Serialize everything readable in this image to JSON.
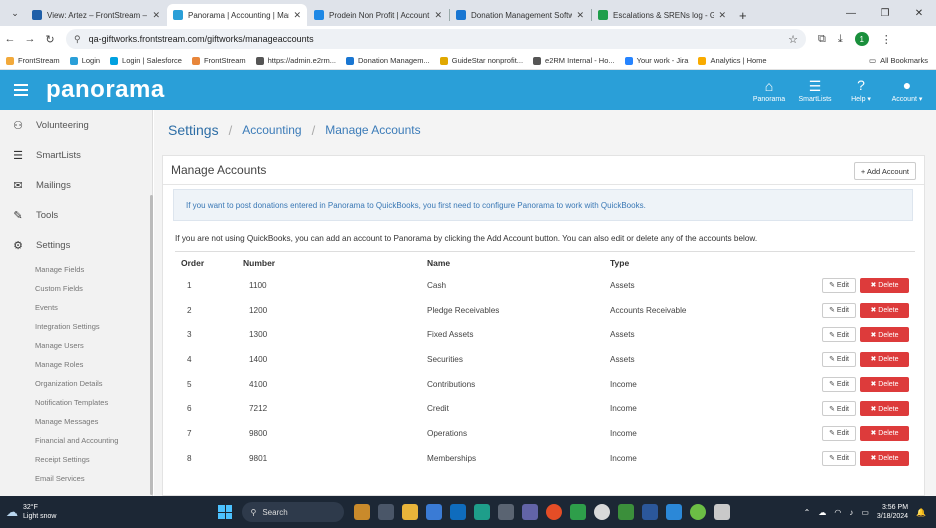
{
  "browser": {
    "tabs": [
      {
        "title": "View: Artez – FrontStream – Ze",
        "color": "#1f5fa8",
        "active": false
      },
      {
        "title": "Panorama | Accounting | Mana",
        "color": "#2a9fd8",
        "active": true
      },
      {
        "title": "Prodein Non Profit | Account | ",
        "color": "#1e88e5",
        "active": false
      },
      {
        "title": "Donation Management Softwa",
        "color": "#1976d2",
        "active": false
      },
      {
        "title": "Escalations & SRENs log - Goog",
        "color": "#1e9e4a",
        "active": false
      }
    ],
    "url": "qa-giftworks.frontstream.com/giftworks/manageaccounts",
    "bookmarks": [
      {
        "label": "FrontStream",
        "color": "#f2a93b"
      },
      {
        "label": "Login",
        "color": "#2a9fd8"
      },
      {
        "label": "Login | Salesforce",
        "color": "#00a1e0"
      },
      {
        "label": "FrontStream",
        "color": "#e8863a"
      },
      {
        "label": "https://admin.e2rm...",
        "color": "#555555"
      },
      {
        "label": "Donation Managem...",
        "color": "#1976d2"
      },
      {
        "label": "GuideStar nonprofit...",
        "color": "#e0a800"
      },
      {
        "label": "e2RM Internal - Ho...",
        "color": "#555555"
      },
      {
        "label": "Your work - Jira",
        "color": "#2684ff"
      },
      {
        "label": "Analytics | Home",
        "color": "#f9ab00"
      }
    ],
    "all_bookmarks": "All Bookmarks",
    "profile_initial": "1"
  },
  "app": {
    "logo": "panorama",
    "header_items": [
      {
        "label": "Panorama",
        "icon": "home-icon",
        "glyph": "⌂"
      },
      {
        "label": "SmartLists",
        "icon": "list-icon",
        "glyph": "☰"
      },
      {
        "label": "Help ▾",
        "icon": "question-icon",
        "glyph": "?"
      },
      {
        "label": "Account ▾",
        "icon": "user-icon",
        "glyph": "●"
      }
    ]
  },
  "sidebar": {
    "main": [
      {
        "label": "Volunteering",
        "icon": "people-icon",
        "glyph": "⚇"
      },
      {
        "label": "SmartLists",
        "icon": "list-icon",
        "glyph": "☰"
      },
      {
        "label": "Mailings",
        "icon": "mail-icon",
        "glyph": "✉"
      },
      {
        "label": "Tools",
        "icon": "wrench-icon",
        "glyph": "✎"
      },
      {
        "label": "Settings",
        "icon": "gear-icon",
        "glyph": "⚙"
      }
    ],
    "sub": [
      "Manage Fields",
      "Custom Fields",
      "Events",
      "Integration Settings",
      "Manage Users",
      "Manage Roles",
      "Organization Details",
      "Notification Templates",
      "Manage Messages",
      "Financial and Accounting",
      "Receipt Settings",
      "Email Services"
    ]
  },
  "breadcrumb": {
    "settings": "Settings",
    "accounting": "Accounting",
    "current": "Manage Accounts"
  },
  "panel": {
    "title": "Manage Accounts",
    "add_button": "+ Add Account",
    "info": "If you want to post donations entered in Panorama to QuickBooks, you first need to configure Panorama to work with QuickBooks.",
    "description": "If you are not using QuickBooks, you can add an account to Panorama by clicking the Add Account button. You can also edit or delete any of the accounts below."
  },
  "table": {
    "headers": {
      "order": "Order",
      "number": "Number",
      "name": "Name",
      "type": "Type"
    },
    "edit_label": "✎ Edit",
    "delete_label": "✖ Delete",
    "rows": [
      {
        "order": "1",
        "number": "1100",
        "name": "Cash",
        "type": "Assets"
      },
      {
        "order": "2",
        "number": "1200",
        "name": "Pledge Receivables",
        "type": "Accounts Receivable"
      },
      {
        "order": "3",
        "number": "1300",
        "name": "Fixed Assets",
        "type": "Assets"
      },
      {
        "order": "4",
        "number": "1400",
        "name": "Securities",
        "type": "Assets"
      },
      {
        "order": "5",
        "number": "4100",
        "name": "Contributions",
        "type": "Income"
      },
      {
        "order": "6",
        "number": "7212",
        "name": "Credit",
        "type": "Income"
      },
      {
        "order": "7",
        "number": "9800",
        "name": "Operations",
        "type": "Income"
      },
      {
        "order": "8",
        "number": "9801",
        "name": "Memberships",
        "type": "Income"
      }
    ]
  },
  "taskbar": {
    "temp": "32°F",
    "weather": "Light snow",
    "search": "Search",
    "time": "3:56 PM",
    "date": "3/18/2024"
  }
}
